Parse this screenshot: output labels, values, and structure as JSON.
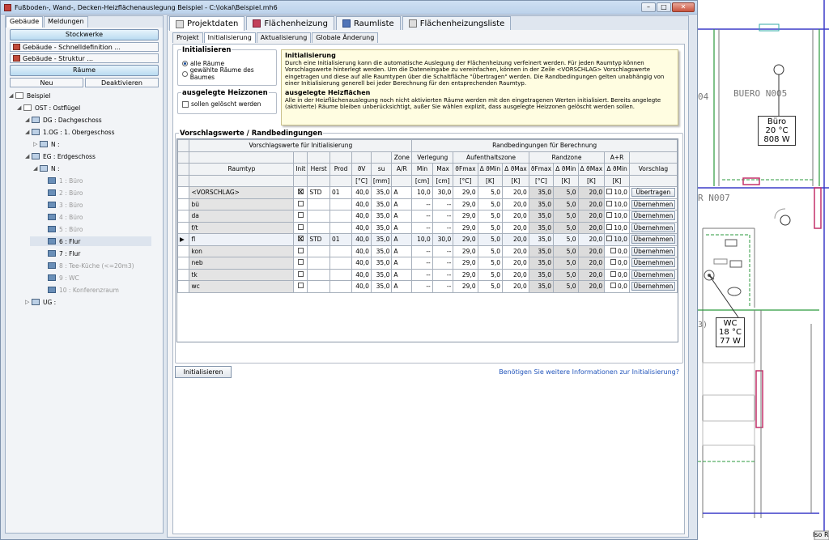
{
  "window": {
    "title": "Fußboden-, Wand-, Decken-Heizflächenauslegung Beispiel - C:\\lokal\\Beispiel.mh6",
    "btn_min": "–",
    "btn_max": "□",
    "btn_close": "✕"
  },
  "left": {
    "tabs": [
      "Gebäude",
      "Meldungen"
    ],
    "stockwerke": "Stockwerke",
    "schnell": "Gebäude - Schnelldefinition ...",
    "struktur": "Gebäude - Struktur ...",
    "raeume": "Räume",
    "neu": "Neu",
    "deaktivieren": "Deaktivieren",
    "tree": [
      {
        "text": "Beispiel",
        "ex": "◢"
      },
      {
        "text": "OST : Ostflügel",
        "ex": "◢"
      },
      {
        "text": "DG : Dachgeschoss",
        "ex": "◢"
      },
      {
        "text": "1.OG : 1. Obergeschoss",
        "ex": "◢"
      },
      {
        "text": "N :",
        "ex": "▷"
      },
      {
        "text": "EG : Erdgeschoss",
        "ex": "◢"
      },
      {
        "text": "N :",
        "ex": "◢"
      },
      {
        "text": "1 : Büro",
        "ex": ""
      },
      {
        "text": "2 : Büro",
        "ex": ""
      },
      {
        "text": "3 : Büro",
        "ex": ""
      },
      {
        "text": "4 : Büro",
        "ex": ""
      },
      {
        "text": "5 : Büro",
        "ex": ""
      },
      {
        "text": "6 : Flur",
        "ex": ""
      },
      {
        "text": "7 : Flur",
        "ex": ""
      },
      {
        "text": "8 : Tee-Küche (<=20m3)",
        "ex": ""
      },
      {
        "text": "9 : WC",
        "ex": ""
      },
      {
        "text": "10 : Konferenzraum",
        "ex": ""
      },
      {
        "text": "UG :",
        "ex": "▷"
      }
    ]
  },
  "main": {
    "tabs": [
      "Projektdaten",
      "Flächenheizung",
      "Raumliste",
      "Flächenheizungsliste"
    ],
    "subtabs": [
      "Projekt",
      "Initialisierung",
      "Aktualisierung",
      "Globale Änderung"
    ],
    "init_group": "Initialisieren",
    "radio_all": "alle Räume",
    "radio_sel": "gewählte Räume des Baumes",
    "heiz_group": "ausgelegte Heizzonen",
    "heiz_chk": "sollen gelöscht werden",
    "info_h1": "Initialisierung",
    "info_p1": "Durch eine Initialisierung kann die automatische Auslegung der Flächenheizung verfeinert werden. Für jeden Raumtyp können Vorschlagswerte hinterlegt werden. Um die Dateneingabe zu vereinfachen, können in der Zeile <VORSCHLAG> Vorschlagswerte eingetragen und diese auf alle Raumtypen über die Schaltfläche \"Übertragen\" werden. Die Randbedingungen gelten unabhängig von einer Initialisierung generell bei jeder Berechnung für den entsprechenden Raumtyp.",
    "info_h2": "ausgelegte Heizflächen",
    "info_p2": "Alle in der Heizflächenauslegung noch nicht aktivierten Räume werden mit den eingetragenen Werten initialisiert. Bereits angelegte (aktivierte) Räume bleiben unberücksichtigt, außer Sie wählen explizit, dass ausgelegte Heizzonen gelöscht werden sollen.",
    "grid_group": "Vorschlagswerte / Randbedingungen",
    "init_btn": "Initialisieren",
    "help_link": "Benötigen Sie weitere Informationen zur Initialisierung?"
  },
  "grid": {
    "hdr_top_left": "Vorschlagswerte für Initialisierung",
    "hdr_top_right": "Randbedingungen für Berechnung",
    "hdr_zone": "Zone",
    "hdr_verlegung": "Verlegung",
    "hdr_aufenthalt": "Aufenthaltszone",
    "hdr_rand": "Randzone",
    "hdr_ar": "A+R",
    "hdr_raumtyp": "Raumtyp",
    "hdr_init": "Init",
    "hdr_herst": "Herst",
    "hdr_prod": "Prod",
    "hdr_tv": "ϑV",
    "hdr_su": "su",
    "hdr_zar": "A/R",
    "hdr_min": "Min",
    "hdr_max": "Max",
    "hdr_afmax": "ϑFmax",
    "hdr_admin": "Δ ϑMin",
    "hdr_admax": "Δ ϑMax",
    "hdr_rfmax": "ϑFmax",
    "hdr_rdmin": "Δ ϑMin",
    "hdr_rdmax": "Δ ϑMax",
    "hdr_ardmin": "Δ ϑMin",
    "hdr_vorschlag": "Vorschlag",
    "u_tv": "[°C]",
    "u_su": "[mm]",
    "u_min": "[cm]",
    "u_max": "[cm]",
    "u_afmax": "[°C]",
    "u_admin": "[K]",
    "u_admax": "[K]",
    "u_rfmax": "[°C]",
    "u_rdmin": "[K]",
    "u_rdmax": "[K]",
    "u_ardmin": "[K]",
    "rows": [
      {
        "typ": "<VORSCHLAG>",
        "init": true,
        "herst": "STD",
        "prod": "01",
        "tv": "40,0",
        "su": "35,0",
        "zar": "A",
        "min": "10,0",
        "max": "30,0",
        "afmax": "29,0",
        "admin": "5,0",
        "admax": "20,0",
        "rfmax": "35,0",
        "rdmin": "5,0",
        "rdmax": "20,0",
        "ar": "10,0",
        "btn": "Übertragen"
      },
      {
        "typ": "bü",
        "init": false,
        "herst": "",
        "prod": "",
        "tv": "40,0",
        "su": "35,0",
        "zar": "A",
        "min": "--",
        "max": "--",
        "afmax": "29,0",
        "admin": "5,0",
        "admax": "20,0",
        "rfmax": "35,0",
        "rdmin": "5,0",
        "rdmax": "20,0",
        "ar": "10,0",
        "btn": "Übernehmen"
      },
      {
        "typ": "da",
        "init": false,
        "herst": "",
        "prod": "",
        "tv": "40,0",
        "su": "35,0",
        "zar": "A",
        "min": "--",
        "max": "--",
        "afmax": "29,0",
        "admin": "5,0",
        "admax": "20,0",
        "rfmax": "35,0",
        "rdmin": "5,0",
        "rdmax": "20,0",
        "ar": "10,0",
        "btn": "Übernehmen"
      },
      {
        "typ": "f/t",
        "init": false,
        "herst": "",
        "prod": "",
        "tv": "40,0",
        "su": "35,0",
        "zar": "A",
        "min": "--",
        "max": "--",
        "afmax": "29,0",
        "admin": "5,0",
        "admax": "20,0",
        "rfmax": "35,0",
        "rdmin": "5,0",
        "rdmax": "20,0",
        "ar": "10,0",
        "btn": "Übernehmen"
      },
      {
        "typ": "fl",
        "init": true,
        "herst": "STD",
        "prod": "01",
        "tv": "40,0",
        "su": "35,0",
        "zar": "A",
        "min": "10,0",
        "max": "30,0",
        "afmax": "29,0",
        "admin": "5,0",
        "admax": "20,0",
        "rfmax": "35,0",
        "rdmin": "5,0",
        "rdmax": "20,0",
        "ar": "10,0",
        "btn": "Übernehmen"
      },
      {
        "typ": "kon",
        "init": false,
        "herst": "",
        "prod": "",
        "tv": "40,0",
        "su": "35,0",
        "zar": "A",
        "min": "--",
        "max": "--",
        "afmax": "29,0",
        "admin": "5,0",
        "admax": "20,0",
        "rfmax": "35,0",
        "rdmin": "5,0",
        "rdmax": "20,0",
        "ar": "0,0",
        "btn": "Übernehmen"
      },
      {
        "typ": "neb",
        "init": false,
        "herst": "",
        "prod": "",
        "tv": "40,0",
        "su": "35,0",
        "zar": "A",
        "min": "--",
        "max": "--",
        "afmax": "29,0",
        "admin": "5,0",
        "admax": "20,0",
        "rfmax": "35,0",
        "rdmin": "5,0",
        "rdmax": "20,0",
        "ar": "0,0",
        "btn": "Übernehmen"
      },
      {
        "typ": "tk",
        "init": false,
        "herst": "",
        "prod": "",
        "tv": "40,0",
        "su": "35,0",
        "zar": "A",
        "min": "--",
        "max": "--",
        "afmax": "29,0",
        "admin": "5,0",
        "admax": "20,0",
        "rfmax": "35,0",
        "rdmin": "5,0",
        "rdmax": "20,0",
        "ar": "0,0",
        "btn": "Übernehmen"
      },
      {
        "typ": "wc",
        "init": false,
        "herst": "",
        "prod": "",
        "tv": "40,0",
        "su": "35,0",
        "zar": "A",
        "min": "--",
        "max": "--",
        "afmax": "29,0",
        "admin": "5,0",
        "admax": "20,0",
        "rfmax": "35,0",
        "rdmin": "5,0",
        "rdmax": "20,0",
        "ar": "0,0",
        "btn": "Übernehmen"
      }
    ]
  },
  "cad": {
    "buero_code": "BUERO N005",
    "r004": "04",
    "r007": "R N007",
    "r3": "3)",
    "buero_label": [
      "Büro",
      "20 °C",
      "808 W"
    ],
    "wc_label": [
      "WC",
      "18 °C",
      "77 W"
    ],
    "iso": "Iso",
    "r": "R"
  }
}
